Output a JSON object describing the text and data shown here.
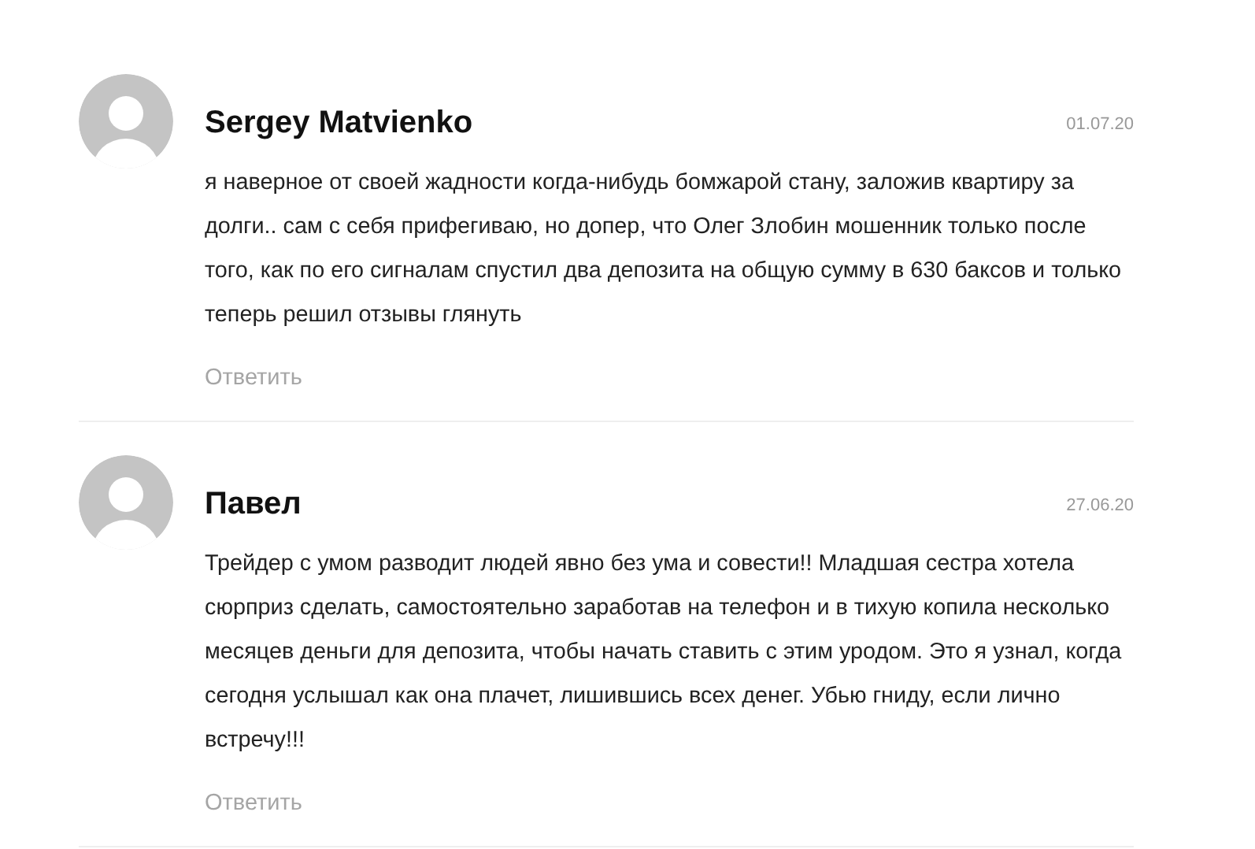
{
  "comments": [
    {
      "author": "Sergey Matvienko",
      "date": "01.07.20",
      "text": "я наверное от своей жадности когда-нибудь бомжарой стану, заложив квартиру за долги.. сам с себя прифегиваю, но допер, что Олег Злобин мошенник только после того, как по его сигналам спустил два депозита на общую сумму в 630 баксов и только теперь решил отзывы глянуть",
      "reply": "Ответить"
    },
    {
      "author": "Павел",
      "date": "27.06.20",
      "text": "Трейдер с умом разводит людей явно без ума и совести!! Младшая сестра хотела сюрприз сделать, самостоятельно заработав на телефон и в тихую копила несколько месяцев деньги для депозита, чтобы начать ставить с этим уродом. Это я узнал, когда сегодня услышал как она плачет, лишившись всех денег. Убью гниду, если лично встречу!!!",
      "reply": "Ответить"
    }
  ]
}
